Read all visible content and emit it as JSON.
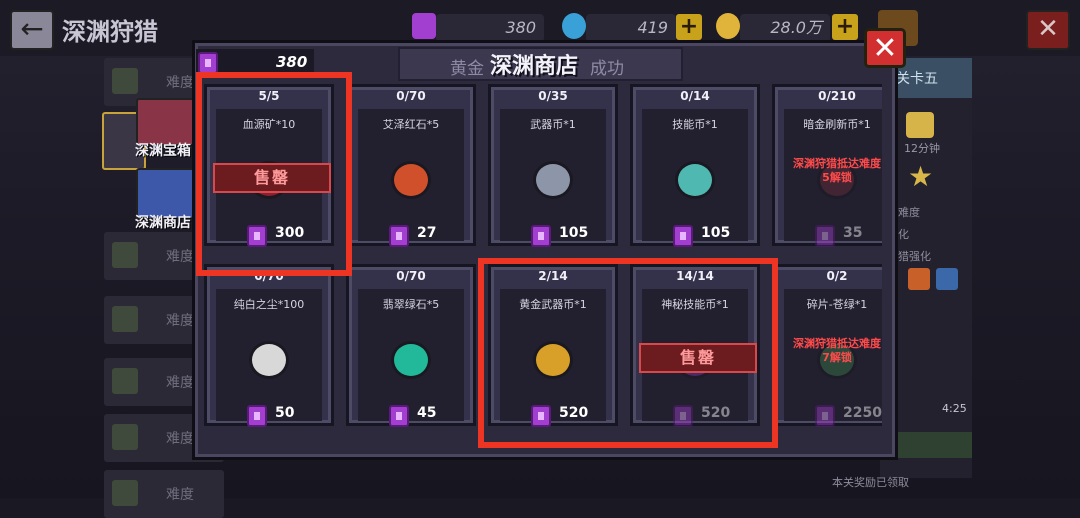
{
  "background": {
    "title": "深渊狩猎",
    "back_icon": "back-arrow-icon",
    "resources": [
      {
        "value": "380",
        "icon": "gem-icon",
        "color": "#a23fd1"
      },
      {
        "value": "419",
        "icon": "diamond-icon",
        "color": "#3aa0d8"
      },
      {
        "value": "28.0万",
        "icon": "coin-icon",
        "color": "#e0b43a"
      }
    ],
    "plus_label": "+",
    "close_label": "✕",
    "sidebar": {
      "items": [
        "难度",
        "难度",
        "难度",
        "难度",
        "难度",
        "难度"
      ],
      "chest_label": "深渊宝箱",
      "shop_label": "深渊商店"
    },
    "right_panel": {
      "title": "关卡五",
      "time": "12分钟",
      "difficulty": "难度",
      "enhance1": "化",
      "enhance2": "猎强化",
      "clock": "4:25",
      "reward": "本关奖励已领取"
    }
  },
  "shop": {
    "title": "深渊商店",
    "title_left_faded": "黄金",
    "title_right_faded": "成功",
    "gem_count": "380",
    "close_label": "✕",
    "sold_out_label": "售罄",
    "items": [
      {
        "stock": "5/5",
        "name": "血源矿*10",
        "price": "300",
        "state": "soldout",
        "icon": "blood-ore-icon",
        "color": "#8a2030"
      },
      {
        "stock": "0/70",
        "name": "艾泽红石*5",
        "price": "27",
        "state": "normal",
        "icon": "red-stone-icon",
        "color": "#d0502c"
      },
      {
        "stock": "0/35",
        "name": "武器币*1",
        "price": "105",
        "state": "normal",
        "icon": "weapon-coin-icon",
        "color": "#8c96a8"
      },
      {
        "stock": "0/14",
        "name": "技能币*1",
        "price": "105",
        "state": "normal",
        "icon": "skill-coin-icon",
        "color": "#4fb8b0"
      },
      {
        "stock": "0/210",
        "name": "暗金刷新币*1",
        "price": "35",
        "state": "locked",
        "lock_line1": "深渊狩猎抵达难度",
        "lock_line2": "5解锁",
        "icon": "dark-gold-refresh-coin-icon",
        "color": "#6a2c3a"
      },
      {
        "stock": "0/70",
        "name": "纯白之尘*100",
        "price": "50",
        "state": "normal",
        "icon": "white-dust-icon",
        "color": "#d8d8d8"
      },
      {
        "stock": "0/70",
        "name": "翡翠绿石*5",
        "price": "45",
        "state": "normal",
        "icon": "emerald-stone-icon",
        "color": "#22b89a"
      },
      {
        "stock": "2/14",
        "name": "黄金武器币*1",
        "price": "520",
        "state": "normal",
        "icon": "gold-weapon-coin-icon",
        "color": "#d8a028"
      },
      {
        "stock": "14/14",
        "name": "神秘技能币*1",
        "price": "520",
        "state": "soldout",
        "icon": "mystery-skill-coin-icon",
        "color": "#7a3aa8"
      },
      {
        "stock": "0/2",
        "name": "碎片-苍绿*1",
        "price": "2250",
        "state": "locked",
        "lock_line1": "深渊狩猎抵达难度",
        "lock_line2": "7解锁",
        "icon": "shard-green-icon",
        "color": "#3a7a4a"
      }
    ]
  },
  "colors": {
    "highlight": "#ee3524",
    "gem": "#a23fd1",
    "modal_bg": "#2d2a3e",
    "sold_out_bg": "#6c1b1e",
    "locked_text": "#ff4a4a"
  }
}
